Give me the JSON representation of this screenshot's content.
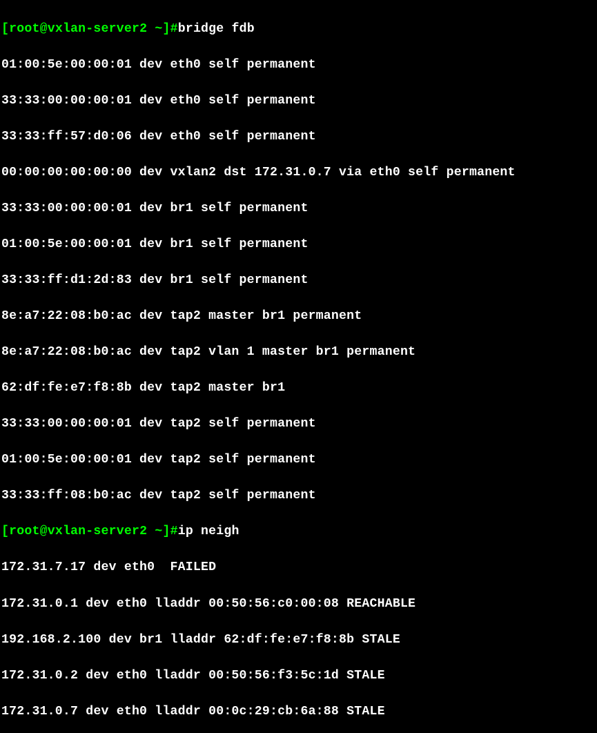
{
  "prompt1": {
    "open_bracket": "[",
    "user": "root",
    "at": "@",
    "host": "vxlan-server2",
    "space": " ",
    "path": "~",
    "close_bracket": "]",
    "hash": "#"
  },
  "command1": "bridge fdb",
  "fdb_output": [
    "01:00:5e:00:00:01 dev eth0 self permanent",
    "33:33:00:00:00:01 dev eth0 self permanent",
    "33:33:ff:57:d0:06 dev eth0 self permanent",
    "00:00:00:00:00:00 dev vxlan2 dst 172.31.0.7 via eth0 self permanent",
    "33:33:00:00:00:01 dev br1 self permanent",
    "01:00:5e:00:00:01 dev br1 self permanent",
    "33:33:ff:d1:2d:83 dev br1 self permanent",
    "8e:a7:22:08:b0:ac dev tap2 master br1 permanent",
    "8e:a7:22:08:b0:ac dev tap2 vlan 1 master br1 permanent",
    "62:df:fe:e7:f8:8b dev tap2 master br1",
    "33:33:00:00:00:01 dev tap2 self permanent",
    "01:00:5e:00:00:01 dev tap2 self permanent",
    "33:33:ff:08:b0:ac dev tap2 self permanent"
  ],
  "prompt2": {
    "open_bracket": "[",
    "user": "root",
    "at": "@",
    "host": "vxlan-server2",
    "space": " ",
    "path": "~",
    "close_bracket": "]",
    "hash": "#"
  },
  "command2": "ip neigh",
  "neigh_output": [
    "172.31.7.17 dev eth0  FAILED",
    "172.31.0.1 dev eth0 lladdr 00:50:56:c0:00:08 REACHABLE",
    "192.168.2.100 dev br1 lladdr 62:df:fe:e7:f8:8b STALE",
    "172.31.0.2 dev eth0 lladdr 00:50:56:f3:5c:1d STALE",
    "172.31.0.7 dev eth0 lladdr 00:0c:29:cb:6a:88 STALE"
  ]
}
